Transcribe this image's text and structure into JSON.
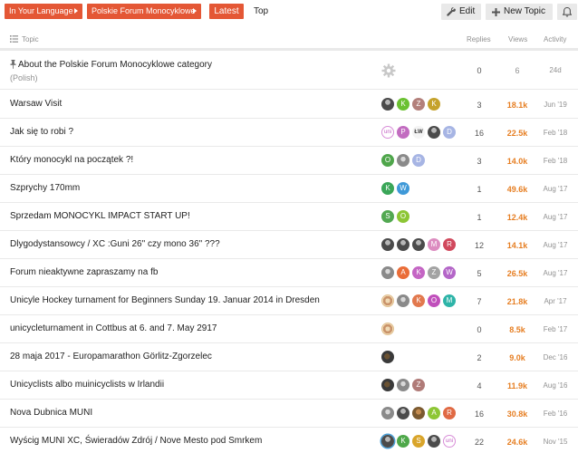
{
  "nav": {
    "crumb_language": "In Your Language",
    "crumb_category": "Polskie Forum Monocyklowe",
    "tab_latest": "Latest",
    "tab_top": "Top",
    "edit_label": "Edit",
    "new_topic_label": "New Topic"
  },
  "table": {
    "col_topic": "Topic",
    "col_replies": "Replies",
    "col_views": "Views",
    "col_activity": "Activity"
  },
  "topics": [
    {
      "title": "About the Polskie Forum Monocyklowe category",
      "sub": "(Polish)",
      "replies": "0",
      "views": "6",
      "activity": "24d"
    },
    {
      "title": "Warsaw Visit",
      "replies": "3",
      "views": "18.1k",
      "activity": "Jun '19"
    },
    {
      "title": "Jak się to robi ?",
      "replies": "16",
      "views": "22.5k",
      "activity": "Feb '18"
    },
    {
      "title": "Który monocykl na początek ?!",
      "replies": "3",
      "views": "14.0k",
      "activity": "Feb '18"
    },
    {
      "title": "Szprychy 170mm",
      "replies": "1",
      "views": "49.6k",
      "activity": "Aug '17"
    },
    {
      "title": "Sprzedam MONOCYKL IMPACT START UP!",
      "replies": "1",
      "views": "12.4k",
      "activity": "Aug '17"
    },
    {
      "title": "Dlygodystansowcy / XC :Guni 26\" czy mono 36\" ???",
      "replies": "12",
      "views": "14.1k",
      "activity": "Aug '17"
    },
    {
      "title": "Forum nieaktywne zapraszamy na fb",
      "replies": "5",
      "views": "26.5k",
      "activity": "Aug '17"
    },
    {
      "title": "Unicyle Hockey turnament for Beginners Sunday 19. Januar 2014 in Dresden",
      "replies": "7",
      "views": "21.8k",
      "activity": "Apr '17"
    },
    {
      "title": "unicycleturnament in Cottbus at 6. and 7. May 2917",
      "replies": "0",
      "views": "8.5k",
      "activity": "Feb '17"
    },
    {
      "title": "28 maja 2017 - Europamarathon Görlitz-Zgorzelec",
      "replies": "2",
      "views": "9.0k",
      "activity": "Dec '16"
    },
    {
      "title": "Unicyclists albo muinicyclists w Irlandii",
      "replies": "4",
      "views": "11.9k",
      "activity": "Aug '16"
    },
    {
      "title": "Nova Dubnica MUNI",
      "replies": "16",
      "views": "30.8k",
      "activity": "Feb '16"
    },
    {
      "title": "Wyścig MUNI XC, Świeradów Zdrój / Nove Mesto pod Smrkem",
      "replies": "22",
      "views": "24.6k",
      "activity": "Nov '15"
    }
  ],
  "avatars": [
    [],
    [
      {
        "t": "",
        "c": "dark"
      },
      {
        "t": "K",
        "c": "#6bc131"
      },
      {
        "t": "Z",
        "c": "#b3807b"
      },
      {
        "t": "K",
        "c": "#c5a22c"
      }
    ],
    [
      {
        "t": "uni",
        "c": "uni"
      },
      {
        "t": "P",
        "c": "#c26cc0"
      },
      {
        "t": "ŁW",
        "c": "lw"
      },
      {
        "t": "",
        "c": "dark"
      },
      {
        "t": "D",
        "c": "#a7b5e4"
      }
    ],
    [
      {
        "t": "O",
        "c": "#4fa64b"
      },
      {
        "t": "",
        "c": "gray"
      },
      {
        "t": "D",
        "c": "#a7b5e4"
      }
    ],
    [
      {
        "t": "K",
        "c": "#3aa658"
      },
      {
        "t": "W",
        "c": "#3f99d8"
      }
    ],
    [
      {
        "t": "S",
        "c": "#52a851"
      },
      {
        "t": "O",
        "c": "#8dc635"
      }
    ],
    [
      {
        "t": "",
        "c": "dark"
      },
      {
        "t": "",
        "c": "dark"
      },
      {
        "t": "",
        "c": "dark"
      },
      {
        "t": "M",
        "c": "#dc8cc0"
      },
      {
        "t": "R",
        "c": "#d1495d"
      }
    ],
    [
      {
        "t": "",
        "c": "gray"
      },
      {
        "t": "A",
        "c": "#ea6d38"
      },
      {
        "t": "K",
        "c": "#c465c4"
      },
      {
        "t": "Z",
        "c": "#a3a3a3"
      },
      {
        "t": "W",
        "c": "#b466c8"
      }
    ],
    [
      {
        "t": "",
        "c": "food"
      },
      {
        "t": "",
        "c": "gray"
      },
      {
        "t": "K",
        "c": "#e2794e"
      },
      {
        "t": "O",
        "c": "#c04fbb"
      },
      {
        "t": "M",
        "c": "#2eb4a8"
      }
    ],
    [
      {
        "t": "",
        "c": "food"
      }
    ],
    [
      {
        "t": "",
        "c": "img"
      }
    ],
    [
      {
        "t": "",
        "c": "img"
      },
      {
        "t": "",
        "c": "gray"
      },
      {
        "t": "Z",
        "c": "#b07b78"
      }
    ],
    [
      {
        "t": "",
        "c": "gray"
      },
      {
        "t": "",
        "c": "dark"
      },
      {
        "t": "",
        "c": "brown"
      },
      {
        "t": "A",
        "c": "#8dc635"
      },
      {
        "t": "R",
        "c": "#e06a44"
      }
    ],
    [
      {
        "t": "",
        "c": "dark-ring"
      },
      {
        "t": "K",
        "c": "#4ea84a"
      },
      {
        "t": "S",
        "c": "#d9a52b"
      },
      {
        "t": "",
        "c": "dark"
      },
      {
        "t": "uni",
        "c": "uni"
      }
    ]
  ],
  "colors": {
    "accent": "#e45735",
    "hot_views": "#e67e22",
    "muted": "#919191"
  }
}
